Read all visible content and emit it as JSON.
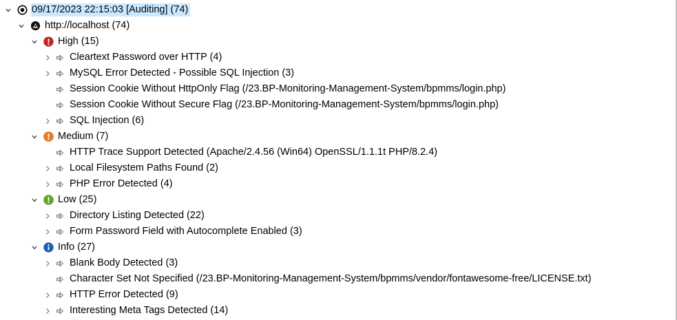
{
  "root": {
    "label": "09/17/2023 22:15:03 [Auditing]",
    "count": "(74)"
  },
  "host": {
    "label": "http://localhost",
    "count": "(74)"
  },
  "groups": [
    {
      "label": "High",
      "count": "(15)",
      "color": "#cc1e1e",
      "items": [
        {
          "label": "Cleartext Password over HTTP (4)",
          "expandable": true
        },
        {
          "label": "MySQL Error Detected - Possible SQL Injection (3)",
          "expandable": true
        },
        {
          "label": "Session Cookie Without HttpOnly Flag  (/23.BP-Monitoring-Management-System/bpmms/login.php)",
          "expandable": false
        },
        {
          "label": "Session Cookie Without Secure Flag  (/23.BP-Monitoring-Management-System/bpmms/login.php)",
          "expandable": false
        },
        {
          "label": "SQL Injection (6)",
          "expandable": true
        }
      ]
    },
    {
      "label": "Medium",
      "count": "(7)",
      "color": "#f07a1a",
      "items": [
        {
          "label": "HTTP Trace Support Detected (Apache/2.4.56 (Win64) OpenSSL/1.1.1t PHP/8.2.4)",
          "expandable": false
        },
        {
          "label": "Local Filesystem Paths Found (2)",
          "expandable": true
        },
        {
          "label": "PHP Error Detected (4)",
          "expandable": true
        }
      ]
    },
    {
      "label": "Low",
      "count": "(25)",
      "color": "#5fa81e",
      "items": [
        {
          "label": "Directory Listing Detected (22)",
          "expandable": true
        },
        {
          "label": "Form Password Field with Autocomplete Enabled (3)",
          "expandable": true
        }
      ]
    },
    {
      "label": "Info",
      "count": "(27)",
      "color": "#1b5fb8",
      "items": [
        {
          "label": "Blank Body Detected (3)",
          "expandable": true
        },
        {
          "label": "Character Set Not Specified  (/23.BP-Monitoring-Management-System/bpmms/vendor/fontawesome-free/LICENSE.txt)",
          "expandable": false
        },
        {
          "label": "HTTP Error Detected (9)",
          "expandable": true
        },
        {
          "label": "Interesting Meta Tags Detected (14)",
          "expandable": true
        }
      ]
    }
  ],
  "icons": {
    "root": "target-icon",
    "host": "host-icon",
    "item": "alert-arrow-icon",
    "High": "high-severity-icon",
    "Medium": "medium-severity-icon",
    "Low": "low-severity-icon",
    "Info": "info-icon"
  }
}
